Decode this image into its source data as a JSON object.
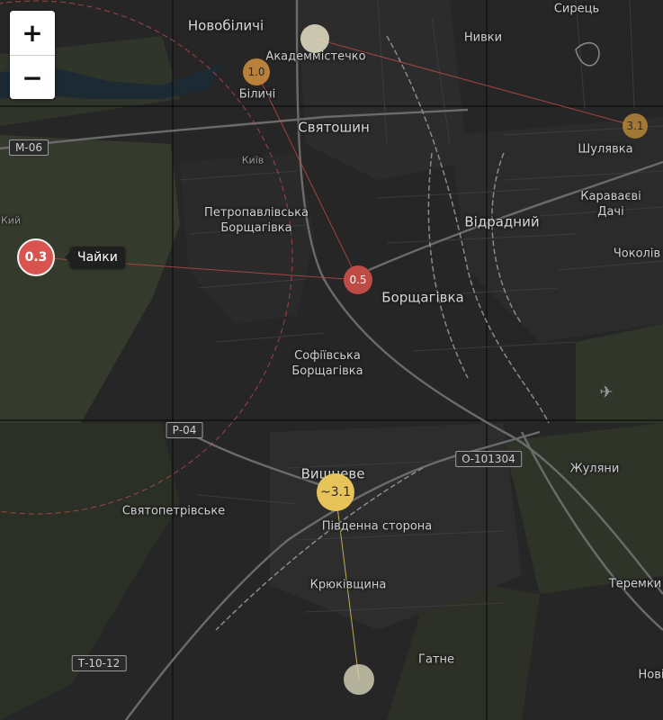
{
  "zoom": {
    "in_label": "+",
    "out_label": "−"
  },
  "places": [
    {
      "id": "novobilychi",
      "text": "Новобіличі",
      "big": true
    },
    {
      "id": "akademmistechko",
      "text": "Академмістечко",
      "big": false
    },
    {
      "id": "bilychi",
      "text": "Біличі",
      "big": false
    },
    {
      "id": "syrets",
      "text": "Сирець",
      "big": false
    },
    {
      "id": "nyvky",
      "text": "Нивки",
      "big": false
    },
    {
      "id": "sviatoshyn",
      "text": "Святошин",
      "big": false
    },
    {
      "id": "shuliavka",
      "text": "Шулявка",
      "big": false
    },
    {
      "id": "karavaievi",
      "text": "Караваєві\nДачі",
      "big": false
    },
    {
      "id": "vidradnyi",
      "text": "Відрадний",
      "big": true
    },
    {
      "id": "chokolivka",
      "text": "Чоколів",
      "big": false
    },
    {
      "id": "petropavlivska",
      "text": "Петропавлівська\nБорщагівка",
      "big": false
    },
    {
      "id": "borshchahivka",
      "text": "Борщагівка",
      "big": false
    },
    {
      "id": "sofiivska",
      "text": "Софіївська\nБорщагівка",
      "big": false
    },
    {
      "id": "kyiv",
      "text": "Київ",
      "big": false
    },
    {
      "id": "vyshneve",
      "text": "Вишневе",
      "big": true
    },
    {
      "id": "pivdenna",
      "text": "Південна сторона",
      "big": false
    },
    {
      "id": "sviatopetrivske",
      "text": "Святопетрівське",
      "big": false
    },
    {
      "id": "zhuliany",
      "text": "Жуляни",
      "big": false
    },
    {
      "id": "kriukivshchyna",
      "text": "Крюківщина",
      "big": false
    },
    {
      "id": "teremky",
      "text": "Теремки",
      "big": false
    },
    {
      "id": "hatne",
      "text": "Гатне",
      "big": false
    },
    {
      "id": "novi",
      "text": "Нові",
      "big": false
    },
    {
      "id": "kyi_left",
      "text": "Кий",
      "big": false
    }
  ],
  "shields": [
    {
      "id": "m06",
      "text": "М-06"
    },
    {
      "id": "r04",
      "text": "Р-04"
    },
    {
      "id": "o101304",
      "text": "О-101304"
    },
    {
      "id": "t1012",
      "text": "Т-10-12"
    }
  ],
  "markers": [
    {
      "id": "m-akadem",
      "label": "",
      "color": "#e8e2c8"
    },
    {
      "id": "m-bilychi",
      "label": "1.0",
      "color": "#c98a3e"
    },
    {
      "id": "m-shuliavka",
      "label": "3.1",
      "color": "#b7863a"
    },
    {
      "id": "m-chaiky",
      "label": "0.3",
      "color": "#d9534f"
    },
    {
      "id": "m-borshch",
      "label": "0.5",
      "color": "#c74e47"
    },
    {
      "id": "m-vyshneve",
      "label": "~3.1",
      "color": "#e6c45a"
    },
    {
      "id": "m-bottom",
      "label": "",
      "color": "#d8d4b8"
    }
  ],
  "tooltip": {
    "text": "Чайки"
  }
}
